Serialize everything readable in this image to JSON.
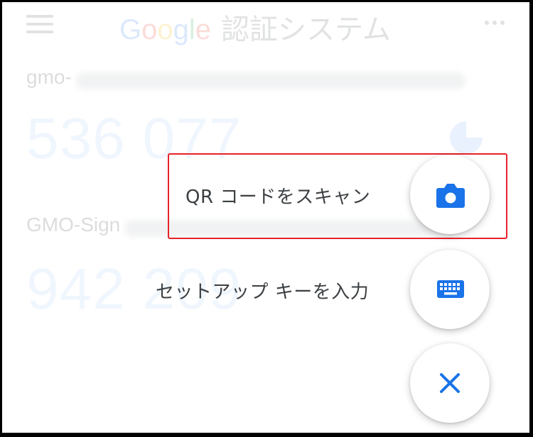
{
  "app_bar": {
    "logo_text": "Google",
    "title": "認証システム",
    "menu_icon": "hamburger-menu-icon",
    "more_icon": "more-vert-icon"
  },
  "accounts": [
    {
      "issuer": "gmo-",
      "code": "536 077"
    },
    {
      "issuer": "GMO-Sign",
      "code": "942 209"
    }
  ],
  "speed_dial": {
    "scan_qr": {
      "label": "QR コードをスキャン",
      "icon": "camera-icon"
    },
    "enter_key": {
      "label": "セットアップ キーを入力",
      "icon": "keyboard-icon"
    },
    "close": {
      "icon": "close-icon"
    }
  },
  "colors": {
    "accent": "#1a73e8",
    "highlight_box": "#e8202a",
    "label_text": "#3c4043"
  }
}
